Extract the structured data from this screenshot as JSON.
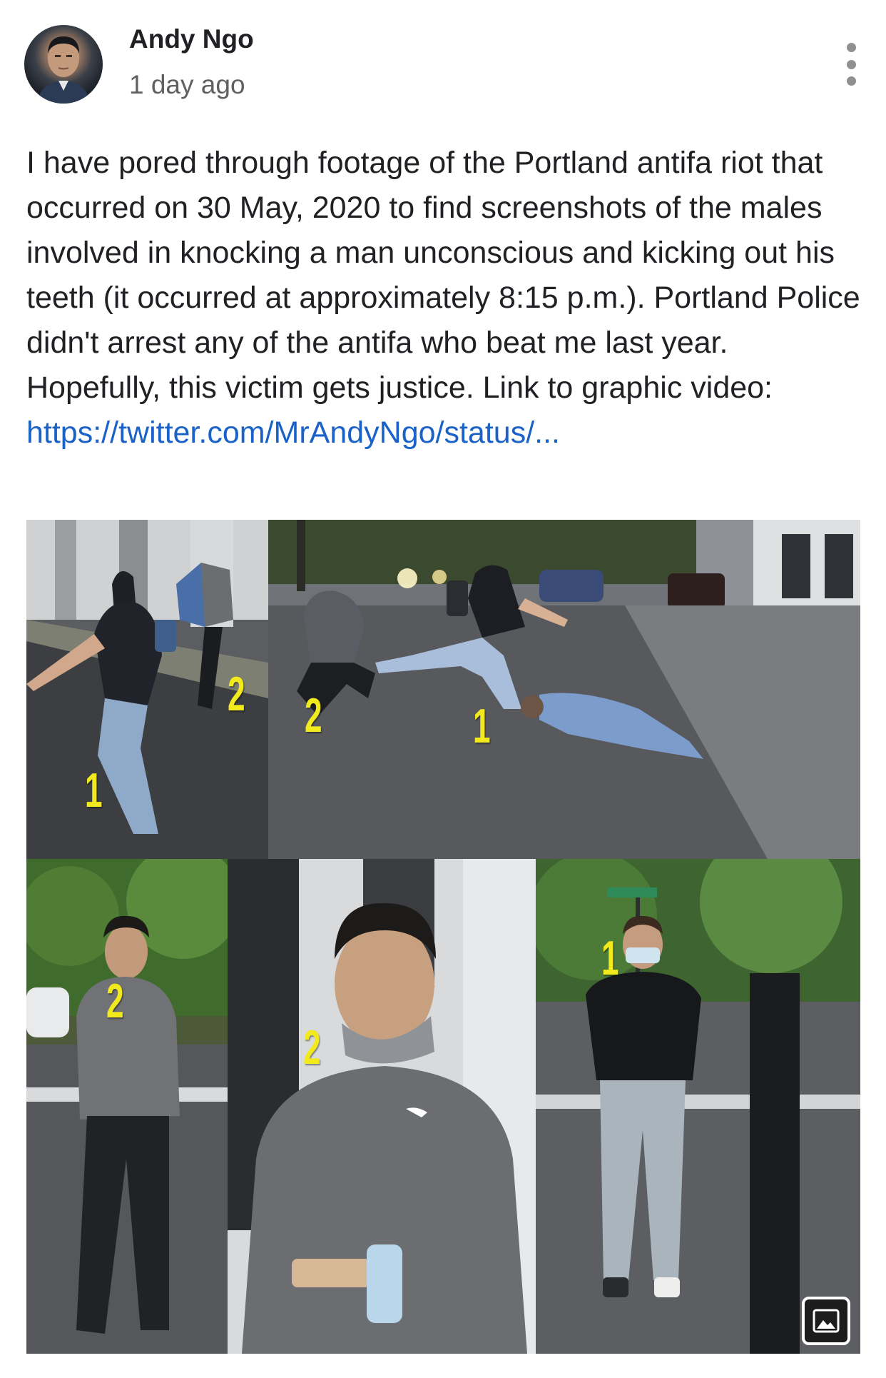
{
  "post": {
    "author": "Andy Ngo",
    "timestamp": "1 day ago",
    "body_text": "I have pored through footage of the Portland antifa riot that occurred on 30 May, 2020 to find screenshots of the males involved in knocking a man unconscious and kicking out his teeth (it occurred at approximately 8:15 p.m.). Portland Police didn't arrest any of the antifa who beat me last year. Hopefully, this victim gets justice. Link to graphic video: ",
    "link_text": "https://twitter.com/MrAndyNgo/status/...",
    "menu_icon": "more-vertical-icon",
    "gallery_icon": "image-gallery-icon"
  },
  "photo_markers": {
    "p1": [
      "2",
      "1"
    ],
    "p2": [
      "2",
      "1"
    ],
    "p3": [
      "2"
    ],
    "p4": [
      "2"
    ],
    "p5": [
      "1"
    ]
  },
  "colors": {
    "link": "#1a62c7",
    "marker": "#f2ea1c",
    "secondary_text": "#606060"
  }
}
